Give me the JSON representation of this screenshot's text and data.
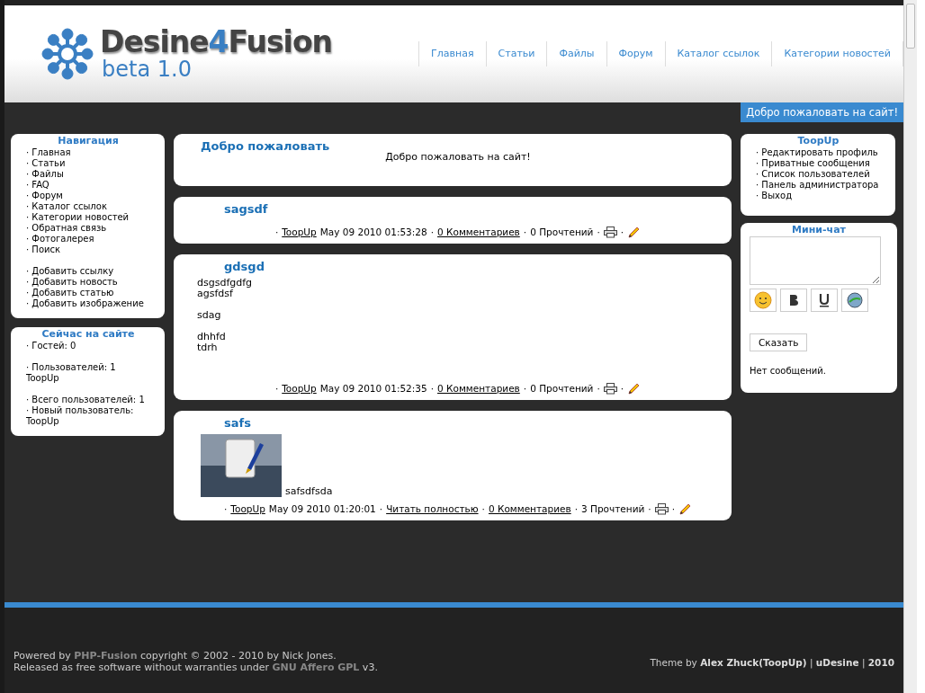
{
  "header": {
    "logo": {
      "before": "Desine",
      "accent": "4",
      "after": "Fusion",
      "subtitle": "beta 1.0"
    },
    "nav": [
      "Главная",
      "Статьи",
      "Файлы",
      "Форум",
      "Каталог ссылок",
      "Категории новостей"
    ],
    "welcome_tab": "Добро пожаловать на сайт!"
  },
  "left_panels": [
    {
      "title": "Навигация",
      "link_groups": [
        [
          "· Главная",
          "· Статьи",
          "· Файлы",
          "· FAQ",
          "· Форум",
          "· Каталог ссылок",
          "· Категории новостей",
          "· Обратная связь",
          "· Фотогалерея",
          "· Поиск"
        ],
        [
          "· Добавить ссылку",
          "· Добавить новость",
          "· Добавить статью",
          "· Добавить изображение"
        ]
      ]
    },
    {
      "title": "Сейчас на сайте",
      "text_groups": [
        [
          "· Гостей: 0"
        ],
        [
          "· Пользователей: 1",
          "ToopUp"
        ],
        [
          "· Всего пользователей: 1",
          "· Новый пользователь: ToopUp"
        ]
      ]
    }
  ],
  "welcome_box": {
    "title": "Добро пожаловать",
    "text": "Добро пожаловать на сайт!"
  },
  "news": [
    {
      "title": "sagsdf",
      "meta": [
        {
          "kind": "sep",
          "text": "·"
        },
        {
          "kind": "link",
          "text": "ToopUp"
        },
        {
          "kind": "text",
          "text": "May 09 2010 01:53:28"
        },
        {
          "kind": "sep",
          "text": "·"
        },
        {
          "kind": "link",
          "text": "0 Комментариев"
        },
        {
          "kind": "sep",
          "text": "·"
        },
        {
          "kind": "text",
          "text": "0 Прочтений"
        },
        {
          "kind": "sep",
          "text": "·"
        },
        {
          "kind": "print"
        },
        {
          "kind": "sep",
          "text": "·"
        },
        {
          "kind": "edit"
        }
      ]
    },
    {
      "title": "gdsgd",
      "paragraphs": [
        [
          "dsgsdfgdfg",
          "agsfdsf"
        ],
        [
          "sdag"
        ],
        [
          "dhhfd",
          "tdrh"
        ]
      ],
      "meta": [
        {
          "kind": "sep",
          "text": "·"
        },
        {
          "kind": "link",
          "text": "ToopUp"
        },
        {
          "kind": "text",
          "text": "May 09 2010 01:52:35"
        },
        {
          "kind": "sep",
          "text": "·"
        },
        {
          "kind": "link",
          "text": "0 Комментариев"
        },
        {
          "kind": "sep",
          "text": "·"
        },
        {
          "kind": "text",
          "text": "0 Прочтений"
        },
        {
          "kind": "sep",
          "text": "·"
        },
        {
          "kind": "print"
        },
        {
          "kind": "sep",
          "text": "·"
        },
        {
          "kind": "edit"
        }
      ]
    },
    {
      "title": "safs",
      "image": {
        "caption": "safsdfsda"
      },
      "meta": [
        {
          "kind": "sep",
          "text": "·"
        },
        {
          "kind": "link",
          "text": "ToopUp"
        },
        {
          "kind": "text",
          "text": "May 09 2010 01:20:01"
        },
        {
          "kind": "sep",
          "text": "·"
        },
        {
          "kind": "link",
          "text": "Читать полностью"
        },
        {
          "kind": "sep",
          "text": "·"
        },
        {
          "kind": "link",
          "text": "0 Комментариев"
        },
        {
          "kind": "sep",
          "text": "·"
        },
        {
          "kind": "text",
          "text": "3 Прочтений"
        },
        {
          "kind": "sep",
          "text": "·"
        },
        {
          "kind": "print"
        },
        {
          "kind": "sep",
          "text": "·"
        },
        {
          "kind": "edit"
        }
      ]
    }
  ],
  "user_panel": {
    "title": "ToopUp",
    "items": [
      "· Редактировать профиль",
      "· Приватные сообщения",
      "· Список пользователей",
      "· Панель администратора",
      "· Выход"
    ]
  },
  "minichat": {
    "title": "Мини-чат",
    "submit": "Сказать",
    "empty": "Нет сообщений."
  },
  "footer": {
    "left": [
      "Powered by **PHP-Fusion** copyright © 2002 - 2010 by Nick Jones.",
      "Released as free software without warranties under **GNU Affero GPL** v3."
    ],
    "right": "Theme by **Alex Zhuck(ToopUp)** | **uDesine** | **2010**"
  }
}
